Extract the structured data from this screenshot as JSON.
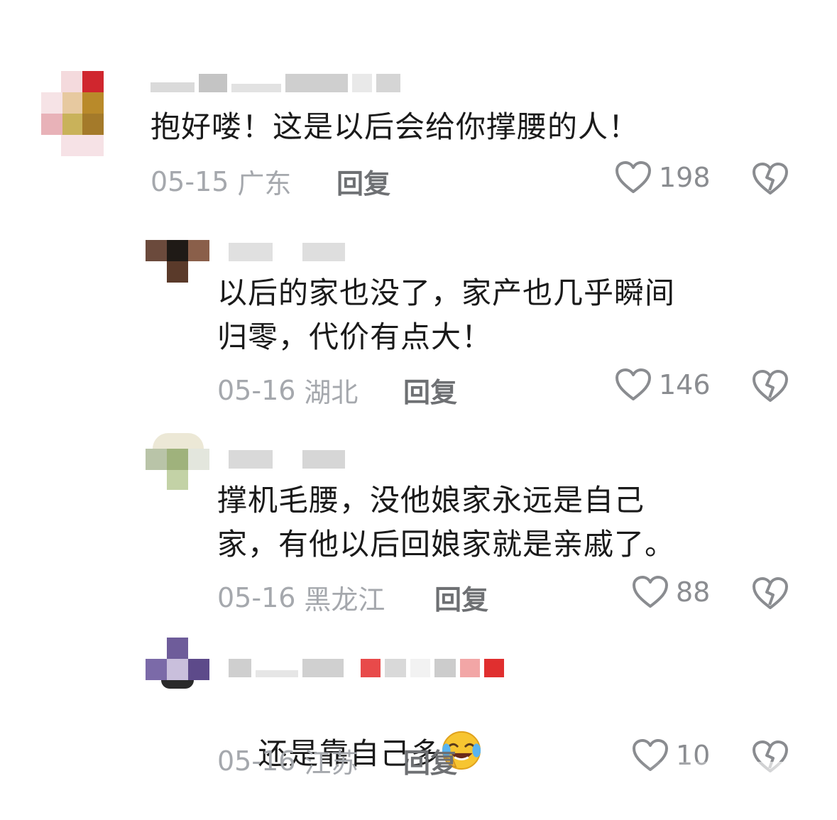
{
  "comments": [
    {
      "text": "抱好喽！这是以后会给你撑腰的人！",
      "time": "05-15",
      "location": "广东",
      "reply_label": "回复",
      "likes": "198",
      "avatar": "pixelated-avatar",
      "like_icon": "heart-outline-icon",
      "dislike_icon": "broken-heart-icon"
    },
    {
      "text": "以后的家也没了，家产也几乎瞬间\n归零，代价有点大！",
      "time": "05-16",
      "location": "湖北",
      "reply_label": "回复",
      "likes": "146",
      "avatar": "pixelated-avatar",
      "like_icon": "heart-outline-icon",
      "dislike_icon": "broken-heart-icon"
    },
    {
      "text": "撑机毛腰，没他娘家永远是自己\n家，有他以后回娘家就是亲戚了。",
      "time": "05-16",
      "location": "黑龙江",
      "reply_label": "回复",
      "likes": "88",
      "avatar": "pixelated-avatar",
      "like_icon": "heart-outline-icon",
      "dislike_icon": "broken-heart-icon"
    },
    {
      "text": "还是靠自己多",
      "emoji": "laughing-crying-emoji",
      "time": "05-16",
      "location": "江苏",
      "reply_label": "回复",
      "likes": "10",
      "avatar": "pixelated-avatar",
      "like_icon": "heart-outline-icon",
      "dislike_icon": "broken-heart-icon"
    }
  ],
  "colors": {
    "text": "#1a1a1a",
    "meta": "#a5a8ad",
    "reply": "#6e7073",
    "icon": "#8a8c90"
  }
}
